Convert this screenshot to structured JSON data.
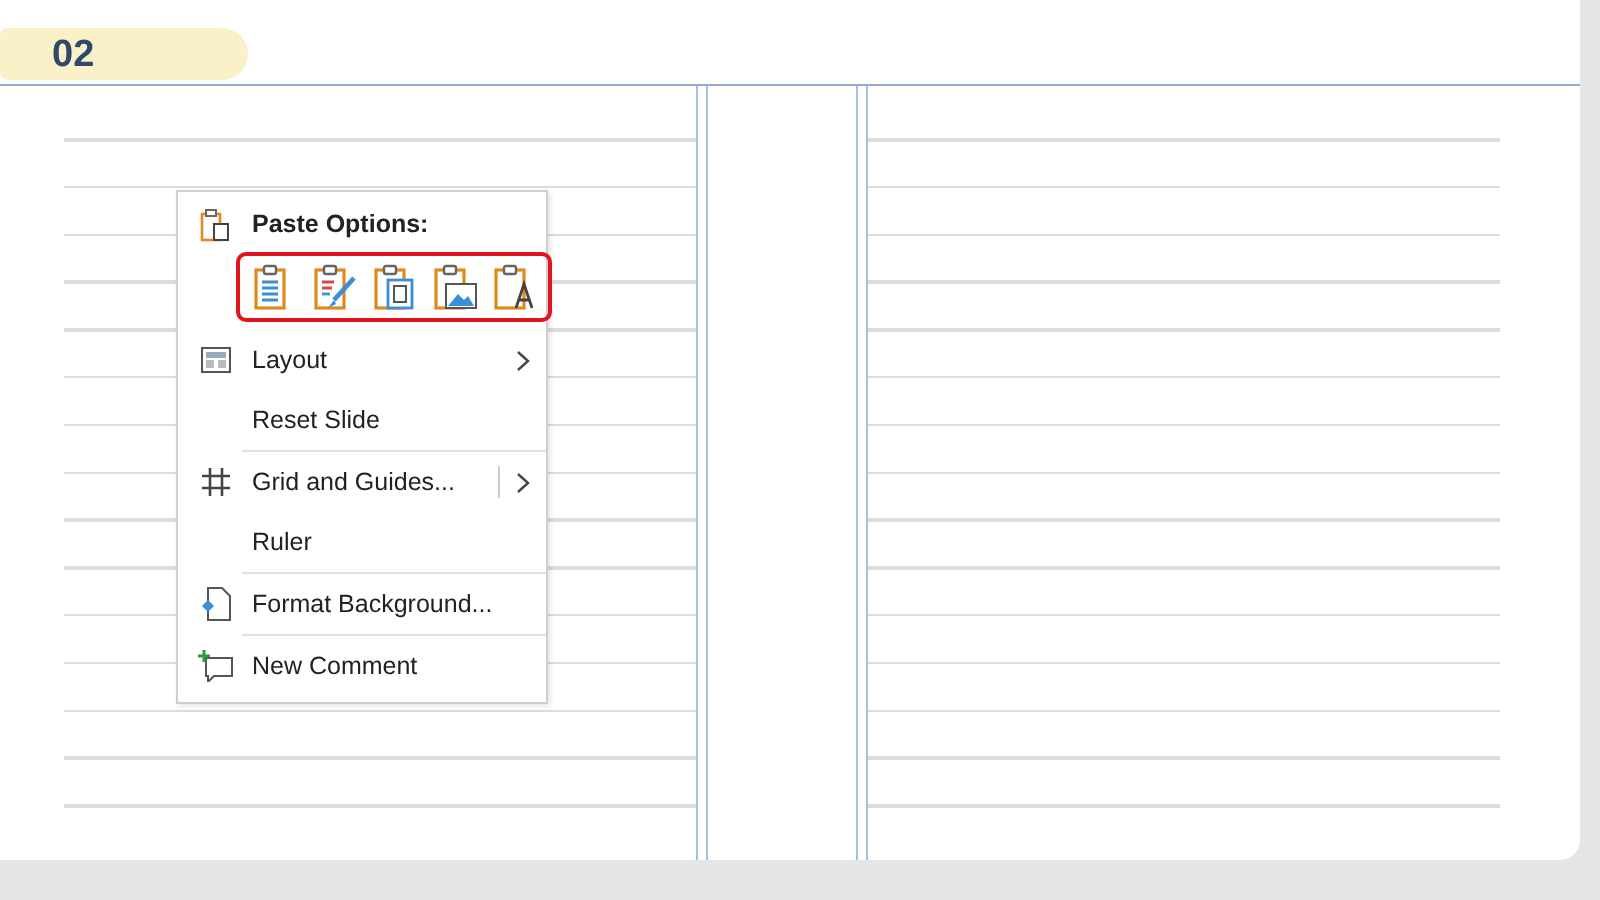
{
  "slide": {
    "number": "02"
  },
  "context_menu": {
    "paste_title": "Paste Options:",
    "paste_highlighted": true,
    "paste_buttons": [
      {
        "kind": "text"
      },
      {
        "kind": "brush"
      },
      {
        "kind": "embed"
      },
      {
        "kind": "image"
      },
      {
        "kind": "letter"
      }
    ],
    "items": [
      {
        "kind": "layout",
        "label": "Layout",
        "submenu": true,
        "split": false
      },
      {
        "kind": "plain",
        "label": "Reset Slide",
        "submenu": false,
        "split": false
      },
      {
        "kind": "separator"
      },
      {
        "kind": "grid",
        "label": "Grid and Guides...",
        "submenu": true,
        "split": true
      },
      {
        "kind": "plain",
        "label": "Ruler",
        "submenu": false,
        "split": false
      },
      {
        "kind": "separator"
      },
      {
        "kind": "format",
        "label": "Format Background...",
        "submenu": false,
        "split": false
      },
      {
        "kind": "separator"
      },
      {
        "kind": "comment",
        "label": "New Comment",
        "submenu": false,
        "split": false
      }
    ]
  }
}
